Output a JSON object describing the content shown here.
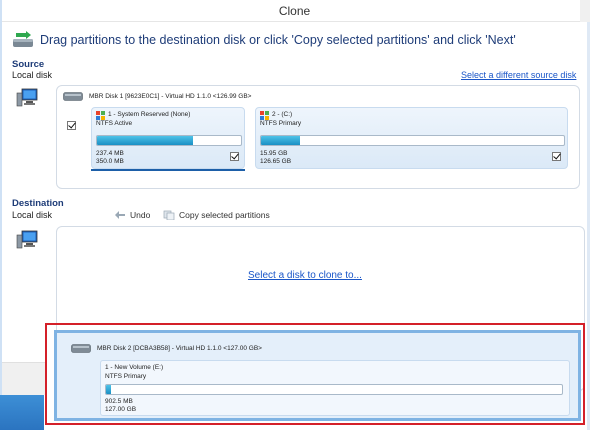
{
  "window": {
    "title": "Clone"
  },
  "header": {
    "text": "Drag partitions to the destination disk or click 'Copy selected partitions' and click 'Next'"
  },
  "source": {
    "title": "Source",
    "subtitle": "Local disk",
    "select_link": "Select a different source disk",
    "disk": {
      "label": "MBR Disk 1 [9623E0C1] - Virtual HD 1.1.0  <126.99 GB>",
      "selected": true,
      "partitions": [
        {
          "name": "1 - System Reserved (None)",
          "type": "NTFS Active",
          "used": "237.4 MB",
          "total": "350.0 MB",
          "fill": 0.67,
          "checked": true
        },
        {
          "name": "2 - (C:)",
          "type": "NTFS Primary",
          "used": "15.95 GB",
          "total": "126.65 GB",
          "fill": 0.13,
          "checked": true
        }
      ]
    }
  },
  "destination": {
    "title": "Destination",
    "subtitle": "Local disk",
    "undo_label": "Undo",
    "copy_label": "Copy selected partitions",
    "placeholder_link": "Select a disk to clone to...",
    "disk": {
      "label": "MBR Disk 2 [DCBA3B58] - Virtual HD 1.1.0  <127.00 GB>",
      "partition": {
        "name": "1 - New Volume (E:)",
        "type": "NTFS Primary",
        "used": "902.5 MB",
        "total": "127.00 GB",
        "fill": 0.01
      }
    }
  },
  "colors": {
    "accent": "#1e3c78",
    "link": "#1a56c8",
    "highlight": "#d42029",
    "bar": "#1a8fc4"
  }
}
